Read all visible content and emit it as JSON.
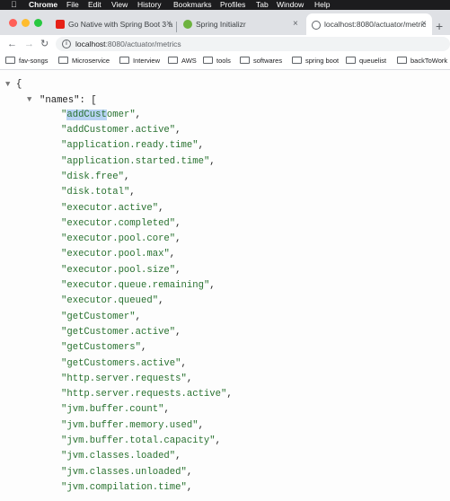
{
  "menubar": {
    "app": "Chrome",
    "items": [
      "File",
      "Edit",
      "View",
      "History",
      "Bookmarks",
      "Profiles",
      "Tab",
      "Window",
      "Help"
    ]
  },
  "tabs": [
    {
      "title": "Go Native with Spring Boot 3 a",
      "icon": "youtube-icon",
      "color": "#e62117"
    },
    {
      "title": "Spring Initializr",
      "icon": "spring-icon",
      "color": "#6db33f"
    },
    {
      "title": "localhost:8080/actuator/metric",
      "icon": "globe-icon",
      "active": true
    }
  ],
  "address_bar": {
    "host": "localhost",
    "path": ":8080/actuator/metrics"
  },
  "bookmarks": [
    "fav-songs",
    "Microservice",
    "Interview",
    "AWS",
    "tools",
    "softwares",
    "spring boot",
    "queuelist",
    "backToWork"
  ],
  "json": {
    "open_brace": "{",
    "key": "\"names\"",
    "colon": ": [",
    "selected_text": "addCust",
    "first_value_rest": "omer",
    "values": [
      "addCustomer.active",
      "application.ready.time",
      "application.started.time",
      "disk.free",
      "disk.total",
      "executor.active",
      "executor.completed",
      "executor.pool.core",
      "executor.pool.max",
      "executor.pool.size",
      "executor.queue.remaining",
      "executor.queued",
      "getCustomer",
      "getCustomer.active",
      "getCustomers",
      "getCustomers.active",
      "http.server.requests",
      "http.server.requests.active",
      "jvm.buffer.count",
      "jvm.buffer.memory.used",
      "jvm.buffer.total.capacity",
      "jvm.classes.loaded",
      "jvm.classes.unloaded",
      "jvm.compilation.time"
    ]
  },
  "colors": {
    "string": "#28712f",
    "selection": "#b7d3f3"
  }
}
